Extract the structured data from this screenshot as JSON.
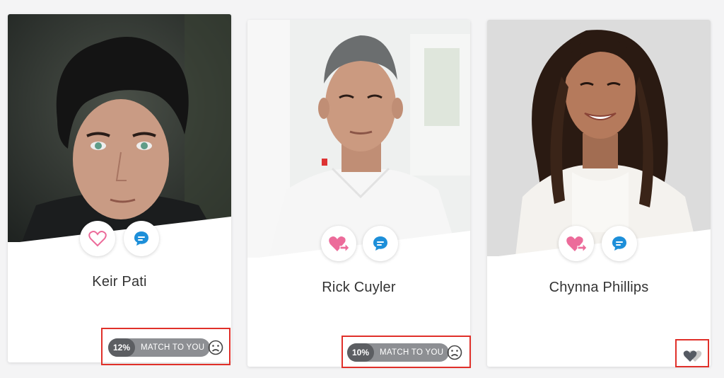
{
  "colors": {
    "heart_pink": "#ec6b9a",
    "chat_blue": "#1d8fd9",
    "highlight_red": "#e0302a",
    "pill_gray": "#8d8f93",
    "pill_dark": "#5c5e62"
  },
  "profiles": [
    {
      "name": "Keir Pati",
      "match_percent": "12%",
      "match_label": "MATCH TO YOU",
      "like_icon": "heart-outline-icon",
      "message_icon": "chat-bubble-icon",
      "status_icon": "sad-face-icon"
    },
    {
      "name": "Rick Cuyler",
      "match_percent": "10%",
      "match_label": "MATCH TO YOU",
      "like_icon": "heart-send-icon",
      "message_icon": "chat-bubble-icon",
      "status_icon": "sad-face-icon"
    },
    {
      "name": "Chynna Phillips",
      "like_icon": "heart-send-icon",
      "message_icon": "chat-bubble-icon",
      "status_icon": "double-heart-icon"
    }
  ]
}
